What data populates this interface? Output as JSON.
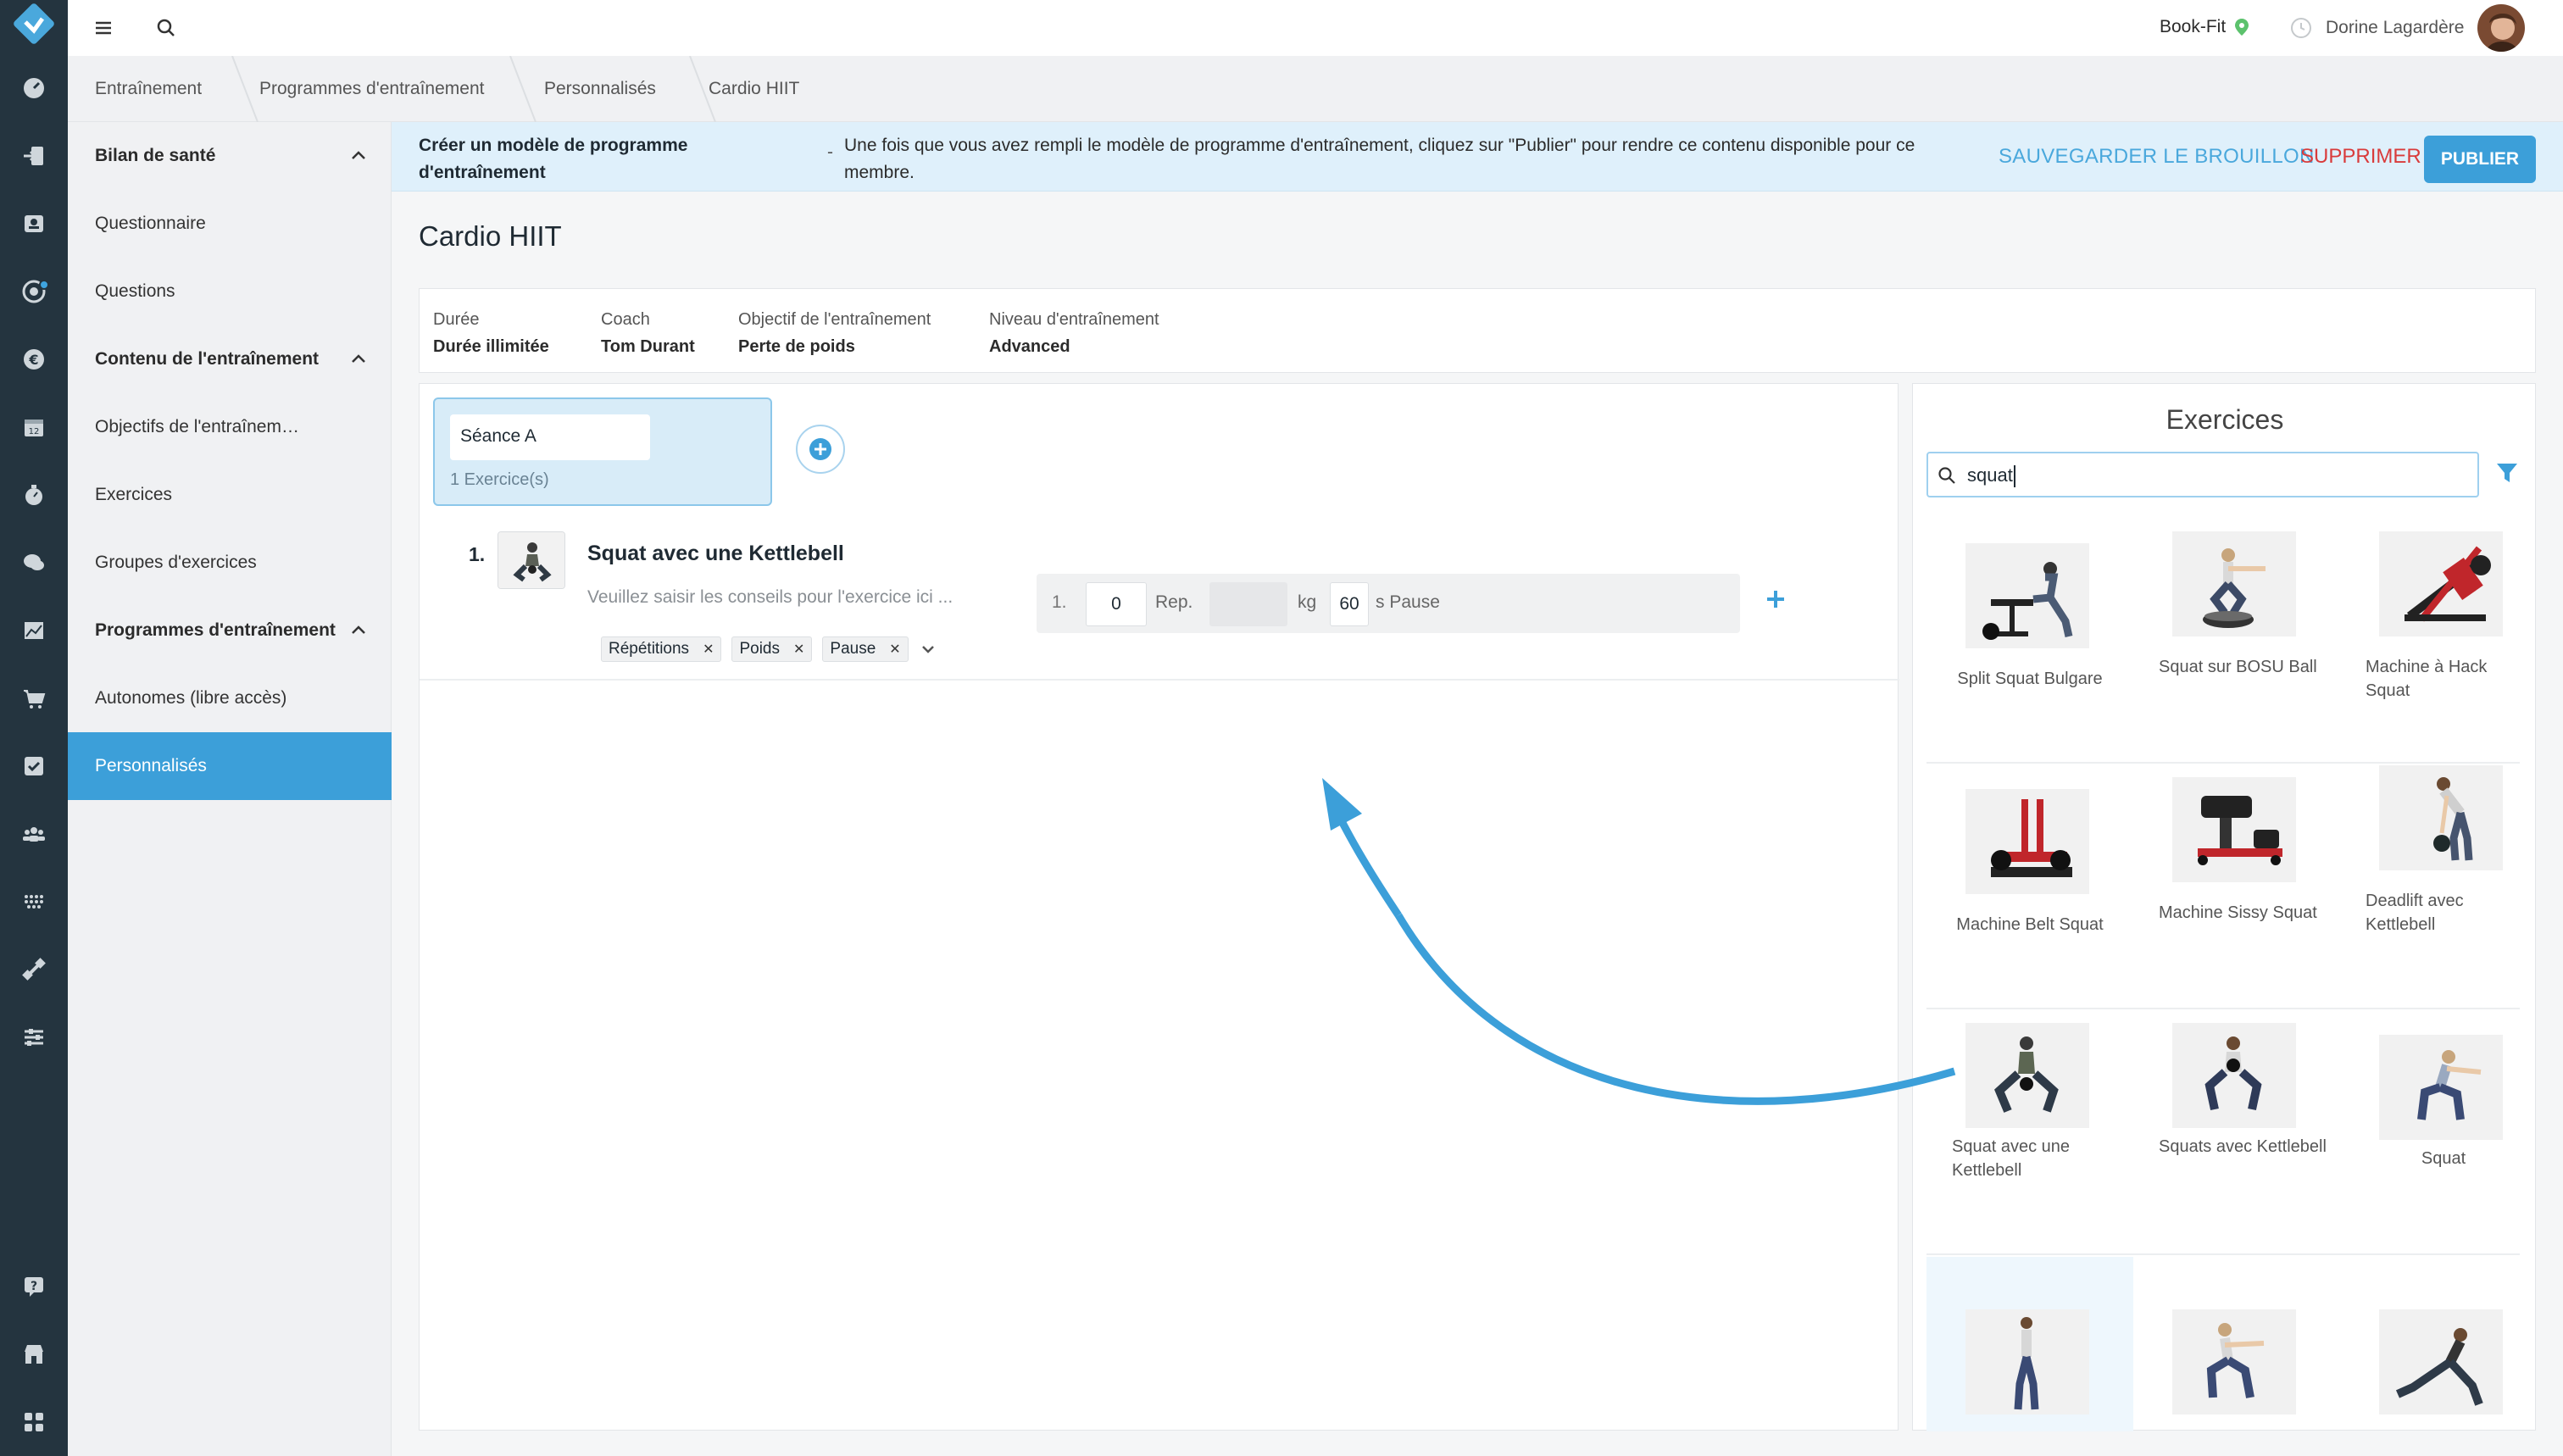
{
  "topbar": {
    "club_name": "Book-Fit",
    "user_name": "Dorine Lagardère"
  },
  "breadcrumb": [
    "Entraînement",
    "Programmes d'entraînement",
    "Personnalisés",
    "Cardio HIIT"
  ],
  "sidebar": {
    "sections": [
      {
        "label": "Bilan de santé",
        "items": [
          "Questionnaire",
          "Questions"
        ]
      },
      {
        "label": "Contenu de l'entraînement",
        "items": [
          "Objectifs de l'entraînem…",
          "Exercices",
          "Groupes d'exercices"
        ]
      },
      {
        "label": "Programmes d'entraînement",
        "items": [
          "Autonomes (libre accès)",
          "Personnalisés"
        ]
      }
    ],
    "active_item": "Personnalisés"
  },
  "banner": {
    "title": "Créer un modèle de programme d'entraînement",
    "dash": "-",
    "text": "Une fois que vous avez rempli le modèle de programme d'entraînement, cliquez sur \"Publier\" pour rendre ce contenu disponible pour ce membre.",
    "save_draft": "SAUVEGARDER LE BROUILLON",
    "delete": "SUPPRIMER",
    "publish": "PUBLIER"
  },
  "program": {
    "title": "Cardio HIIT",
    "meta": [
      {
        "label": "Durée",
        "value": "Durée illimitée"
      },
      {
        "label": "Coach",
        "value": "Tom Durant"
      },
      {
        "label": "Objectif de l'entraînement",
        "value": "Perte de poids"
      },
      {
        "label": "Niveau d'entraînement",
        "value": "Advanced"
      }
    ]
  },
  "session": {
    "name": "Séance A",
    "count": "1 Exercice(s)"
  },
  "exercise": {
    "number": "1.",
    "name": "Squat avec une Kettlebell",
    "hint_placeholder": "Veuillez saisir les conseils pour l'exercice ici ...",
    "tags": [
      "Répétitions",
      "Poids",
      "Pause"
    ],
    "set": {
      "index": "1.",
      "reps": "0",
      "reps_label": "Rep.",
      "weight": "",
      "weight_label": "kg",
      "pause": "60",
      "pause_label": "s Pause"
    }
  },
  "library": {
    "title": "Exercices",
    "search_value": "squat",
    "items": [
      "Split Squat Bulgare",
      "Squat sur BOSU Ball",
      "Machine à Hack Squat",
      "Machine Belt Squat",
      "Machine Sissy Squat",
      "Deadlift avec Kettlebell",
      "Squat avec une Kettlebell",
      "Squats avec Kettlebell",
      "Squat",
      "",
      "",
      ""
    ]
  },
  "colors": {
    "rail": "#24343f",
    "accent": "#3c9fd9",
    "danger": "#d93b3b",
    "banner": "#dff0fb"
  }
}
